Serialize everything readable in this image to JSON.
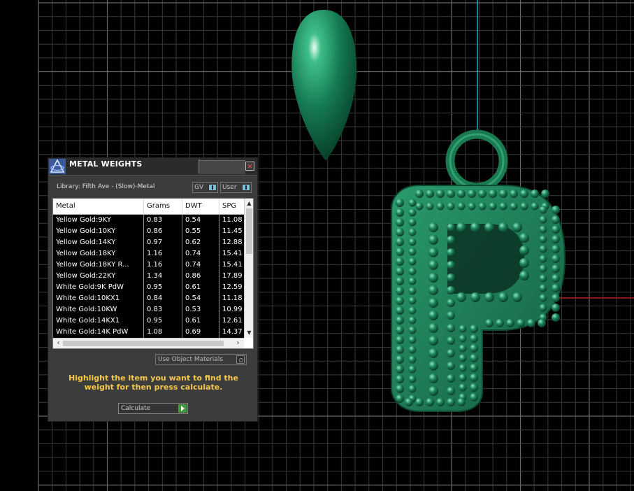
{
  "panel": {
    "title": "METAL WEIGHTS",
    "library": "Library: Fifth Ave - (Slow)-Metal",
    "gv_label": "GV",
    "user_label": "User",
    "columns": [
      "Metal",
      "Grams",
      "DWT",
      "SPG"
    ],
    "rows": [
      [
        "Yellow Gold:9KY",
        "0.83",
        "0.54",
        "11.08"
      ],
      [
        "Yellow Gold:10KY",
        "0.86",
        "0.55",
        "11.45"
      ],
      [
        "Yellow Gold:14KY",
        "0.97",
        "0.62",
        "12.88"
      ],
      [
        "Yellow Gold:18KY",
        "1.16",
        "0.74",
        "15.41"
      ],
      [
        "Yellow Gold:18KY R...",
        "1.16",
        "0.74",
        "15.41"
      ],
      [
        "Yellow Gold:22KY",
        "1.34",
        "0.86",
        "17.89"
      ],
      [
        "White Gold:9K PdW",
        "0.95",
        "0.61",
        "12.59"
      ],
      [
        "White Gold:10KX1",
        "0.84",
        "0.54",
        "11.18"
      ],
      [
        "White Gold:10KW",
        "0.83",
        "0.53",
        "10.99"
      ],
      [
        "White Gold:14KX1",
        "0.95",
        "0.61",
        "12.61"
      ],
      [
        "White Gold:14K PdW",
        "1.08",
        "0.69",
        "14.37"
      ]
    ],
    "use_object_materials": "Use Object Materials",
    "hint": "Highlight the item you want to find the weight for then press calculate.",
    "calculate": "Calculate"
  },
  "colors": {
    "model_green": "#1f7a55",
    "hint_yellow": "#f5c84a",
    "axis_cyan": "#2fa7c0",
    "axis_red": "#b02020"
  }
}
